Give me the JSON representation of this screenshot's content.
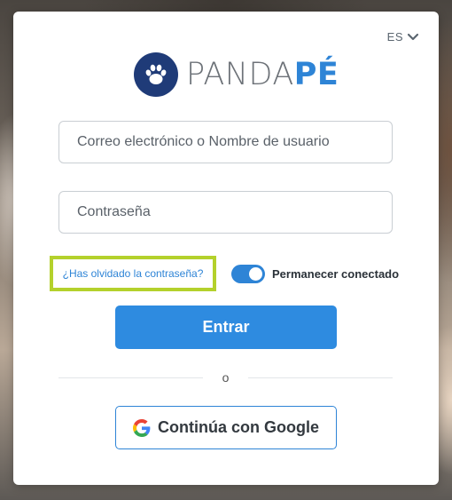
{
  "language": {
    "label": "ES"
  },
  "brand": {
    "name_part1": "PANDA",
    "name_part2": "PÉ"
  },
  "form": {
    "username_placeholder": "Correo electrónico o Nombre de usuario",
    "password_placeholder": "Contraseña",
    "forgot_password": "¿Has olvidado la contraseña?",
    "remember_label": "Permanecer conectado",
    "remember_checked": true,
    "submit_label": "Entrar"
  },
  "separator": {
    "label": "o"
  },
  "google": {
    "label": "Continúa con Google"
  },
  "colors": {
    "brand_blue": "#2e84d6",
    "logo_navy": "#1f3b78",
    "highlight": "#b4d12c"
  }
}
